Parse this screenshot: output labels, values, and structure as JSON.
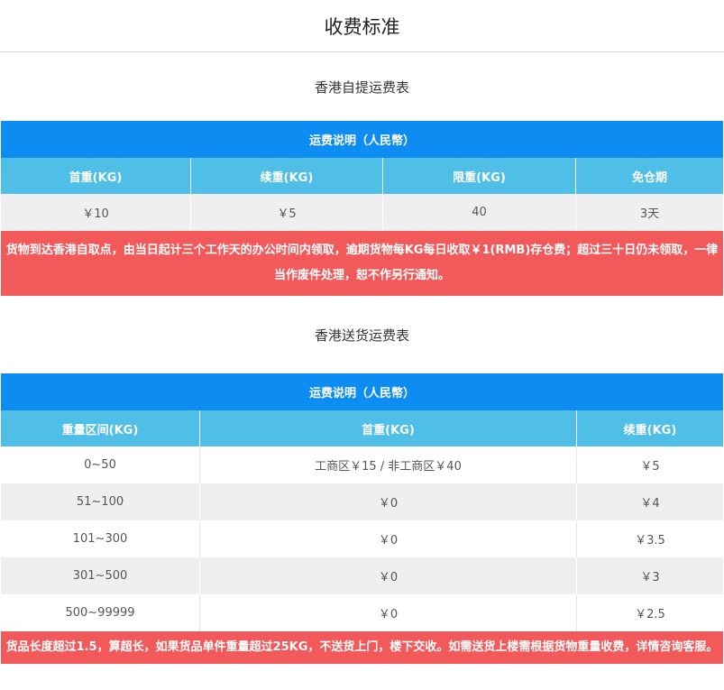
{
  "page": {
    "title": "收费标准"
  },
  "self_pickup": {
    "section_title": "香港自提运费表",
    "header": "运费说明（人民幣）",
    "columns": [
      "首重(KG)",
      "续重(KG)",
      "限重(KG)",
      "免仓期"
    ],
    "row": [
      "￥10",
      "￥5",
      "40",
      "3天"
    ],
    "note": "货物到达香港自取点，由当日起计三个工作天的办公时间内领取，逾期货物每KG每日收取￥1(RMB)存仓费；超过三十日仍未领取，一律当作废件处理，恕不作另行通知。"
  },
  "delivery": {
    "section_title": "香港送货运费表",
    "header": "运费说明（人民幣）",
    "columns": [
      "重量区间(KG)",
      "首重(KG)",
      "续重(KG)"
    ],
    "rows": [
      [
        "0~50",
        "工商区￥15 / 非工商区￥40",
        "￥5"
      ],
      [
        "51~100",
        "￥0",
        "￥4"
      ],
      [
        "101~300",
        "￥0",
        "￥3.5"
      ],
      [
        "301~500",
        "￥0",
        "￥3"
      ],
      [
        "500~99999",
        "￥0",
        "￥2.5"
      ]
    ],
    "note": "货品长度超过1.5，算超长，如果货品单件重量超过25KG，不送货上门，楼下交收。如需送货上楼需根据货物重量收费，详情咨询客服。"
  },
  "colors": {
    "header_blue": "#0d8cf2",
    "column_blue": "#4fbfe8",
    "note_red": "#f2595a",
    "row_grey": "#efefef"
  }
}
